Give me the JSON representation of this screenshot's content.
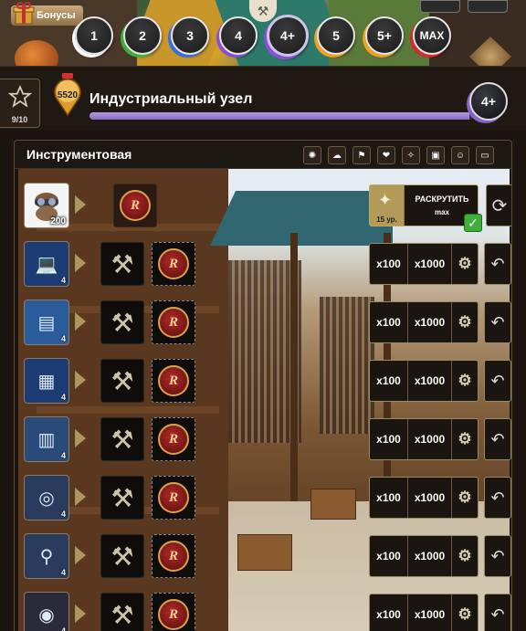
{
  "top": {
    "bonus_label": "Бонусы",
    "levels": [
      {
        "label": "1",
        "color": "#1a1a1a",
        "ring": "#ffffff"
      },
      {
        "label": "2",
        "color": "#1a1a1a",
        "ring": "#3fae3a"
      },
      {
        "label": "3",
        "color": "#1a1a1a",
        "ring": "#3a6fd6"
      },
      {
        "label": "4",
        "color": "#1a1a1a",
        "ring": "#8a4fd8"
      },
      {
        "label": "4+",
        "color": "#1a1a1a",
        "ring": "#8a4fd8",
        "selected": true
      },
      {
        "label": "5",
        "color": "#1a1a1a",
        "ring": "#f0a020"
      },
      {
        "label": "5+",
        "color": "#1a1a1a",
        "ring": "#f0a020"
      },
      {
        "label": "MAX",
        "color": "#1a1a1a",
        "ring": "#d42a2a"
      }
    ]
  },
  "header": {
    "star_count": "9/10",
    "pin_number": "5520",
    "title": "Индустриальный узел",
    "progress": 0.99,
    "grade_badge": "4+"
  },
  "panel": {
    "title": "Инструментовая",
    "filter_icons": [
      "gear-filter-icon",
      "hat-filter-icon",
      "boot-filter-icon",
      "heart-filter-icon",
      "bulb-filter-icon",
      "card-filter-icon",
      "mask-filter-icon",
      "battery-filter-icon"
    ],
    "first_row": {
      "item_count": "200",
      "unlock_label": "РАСКРУТИТЬ",
      "unlock_sub": "max",
      "required_level": "15 ур."
    },
    "rows": [
      {
        "item": "laptop",
        "count": "4",
        "x100": "x100",
        "x1000": "x1000"
      },
      {
        "item": "tablet",
        "count": "4",
        "x100": "x100",
        "x1000": "x1000"
      },
      {
        "item": "terminal",
        "count": "4",
        "x100": "x100",
        "x1000": "x1000"
      },
      {
        "item": "cooler",
        "count": "4",
        "x100": "x100",
        "x1000": "x1000"
      },
      {
        "item": "vr-goggles",
        "count": "4",
        "x100": "x100",
        "x1000": "x1000"
      },
      {
        "item": "key-device",
        "count": "4",
        "x100": "x100",
        "x1000": "x1000"
      },
      {
        "item": "night-goggles",
        "count": "4",
        "x100": "x100",
        "x1000": "x1000"
      }
    ],
    "coin_letter": "R"
  }
}
